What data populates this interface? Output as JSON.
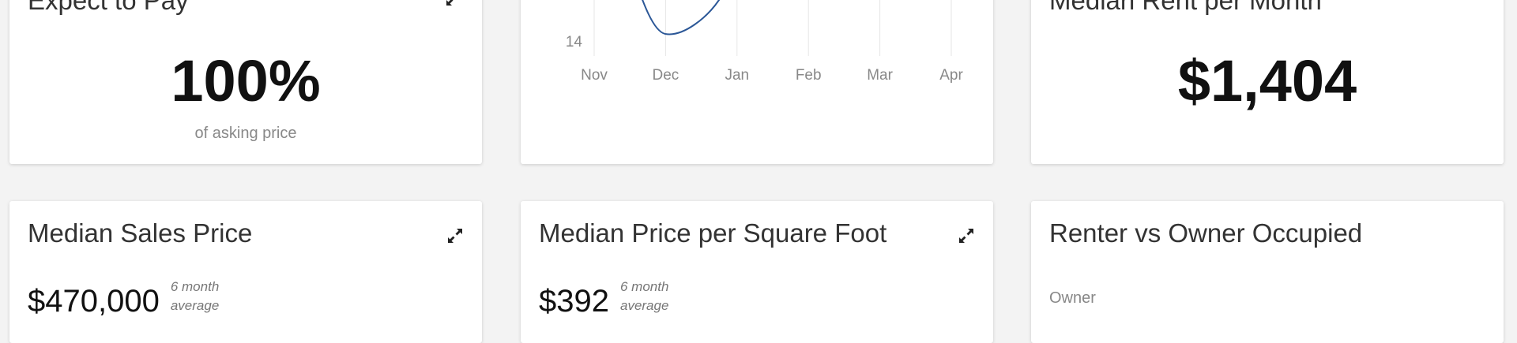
{
  "cards": {
    "expect_to_pay": {
      "title": "Expect to Pay",
      "value": "100%",
      "caption": "of asking price"
    },
    "trend_chart": {
      "y_tick": "14",
      "x_ticks": [
        "Nov",
        "Dec",
        "Jan",
        "Feb",
        "Mar",
        "Apr"
      ],
      "line_color": "#2b5797"
    },
    "median_rent": {
      "title": "Median Rent per Month",
      "value": "$1,404"
    },
    "median_sales_price": {
      "title": "Median Sales Price",
      "value": "$470,000",
      "note_line1": "6 month",
      "note_line2": "average",
      "expand_icon": "expand-icon"
    },
    "median_price_sqft": {
      "title": "Median Price per Square Foot",
      "value": "$392",
      "note_line1": "6 month",
      "note_line2": "average",
      "expand_icon": "expand-icon"
    },
    "renter_vs_owner": {
      "title": "Renter vs Owner Occupied",
      "owner_label": "Owner"
    }
  },
  "chart_data": {
    "type": "line",
    "categories": [
      "Nov",
      "Dec",
      "Jan",
      "Feb",
      "Mar",
      "Apr"
    ],
    "visible_y_tick": 14,
    "series": [
      {
        "values": [
          null,
          14,
          null,
          null,
          null,
          null
        ]
      }
    ],
    "grid": true
  }
}
